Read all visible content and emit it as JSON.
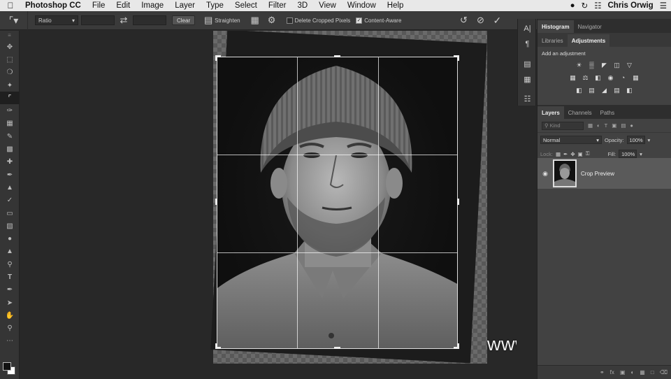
{
  "menubar": {
    "app_name": "Photoshop CC",
    "items": [
      "File",
      "Edit",
      "Image",
      "Layer",
      "Type",
      "Select",
      "Filter",
      "3D",
      "View",
      "Window",
      "Help"
    ],
    "user": "Chris Orwig"
  },
  "options": {
    "ratio_label": "Ratio",
    "clear_label": "Clear",
    "straighten_label": "Straighten",
    "delete_cropped_label": "Delete Cropped Pixels",
    "delete_cropped_checked": false,
    "content_aware_label": "Content-Aware",
    "content_aware_checked": true
  },
  "panels": {
    "top_tabs": [
      "Histogram",
      "Navigator"
    ],
    "adj_tabs": [
      "Libraries",
      "Adjustments"
    ],
    "adj_active": "Adjustments",
    "adj_title": "Add an adjustment",
    "layer_tabs": [
      "Layers",
      "Channels",
      "Paths"
    ],
    "layer_active": "Layers",
    "kind_placeholder": "Kind",
    "blend_mode": "Normal",
    "opacity_label": "Opacity:",
    "opacity_value": "100%",
    "lock_label": "Lock:",
    "fill_label": "Fill:",
    "fill_value": "100%",
    "layers": [
      {
        "name": "Crop Preview",
        "visible": true
      }
    ]
  },
  "watermark": "www.hunls.com",
  "colors": {
    "menubar_bg": "#e8e8e8",
    "chrome_bg": "#3a3a3a",
    "canvas_bg": "#282828",
    "panel_bg": "#424242",
    "selected_layer_bg": "#5a5a5a"
  }
}
